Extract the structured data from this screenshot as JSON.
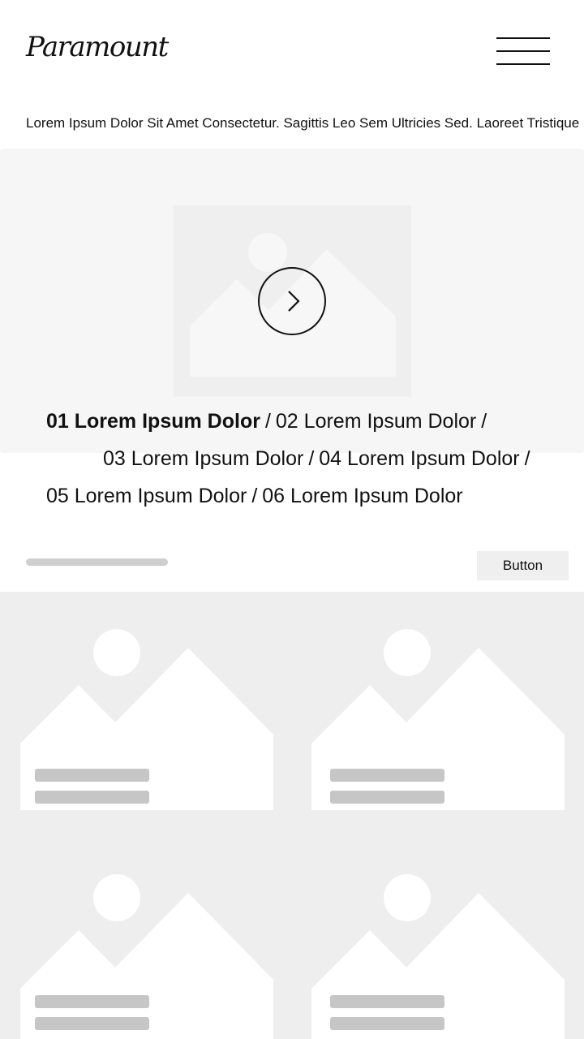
{
  "header": {
    "logo_text": "Paramount",
    "menu_icon": "hamburger-menu-icon"
  },
  "ticker": {
    "text": "Lorem Ipsum Dolor Sit Amet Consectetur. Sagittis Leo Sem Ultricies Sed. Laoreet Tristique"
  },
  "hero": {
    "media_icon": "image-placeholder-icon",
    "play_icon": "chevron-right-icon",
    "episodes": [
      {
        "label": "01 Lorem Ipsum Dolor",
        "active": true
      },
      {
        "label": "02 Lorem Ipsum Dolor",
        "active": false
      },
      {
        "label": "03 Lorem Ipsum Dolor",
        "active": false
      },
      {
        "label": "04 Lorem Ipsum Dolor",
        "active": false
      },
      {
        "label": "05 Lorem Ipsum Dolor",
        "active": false
      },
      {
        "label": "06 Lorem Ipsum Dolor",
        "active": false
      }
    ],
    "separator": "/"
  },
  "controls": {
    "button_label": "Button"
  },
  "colors": {
    "text": "#111111",
    "hero_bg": "#f6f6f6",
    "grid_bg": "#eeeeee",
    "placeholder": "#c6c6c6"
  }
}
